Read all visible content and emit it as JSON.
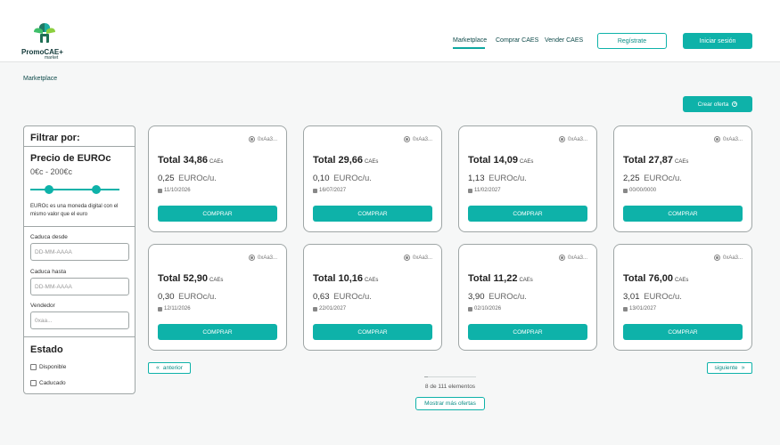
{
  "brand": {
    "name": "PromoCAE+",
    "sub": "market"
  },
  "nav": {
    "items": [
      "Marketplace",
      "Comprar CAES",
      "Vender CAES"
    ],
    "register_label": "Regístrate",
    "login_label": "Iniciar sesión"
  },
  "breadcrumb": "Marketplace",
  "create_offer_label": "Crear oferta",
  "filter": {
    "title": "Filtrar por:",
    "price_title": "Precio de EUROc",
    "price_range": "0€c - 200€c",
    "price_slider_min_fraction": 0.21,
    "price_slider_max_fraction": 0.74,
    "note": "EUROc es una moneda digital con el mismo valor que el euro",
    "caduca_desde_label": "Caduca desde",
    "caduca_desde_placeholder": "DD-MM-AAAA",
    "caduca_hasta_label": "Caduca hasta",
    "caduca_hasta_placeholder": "DD-MM-AAAA",
    "vendedor_label": "Vendedor",
    "vendedor_placeholder": "0xaa...",
    "estado_title": "Estado",
    "disponible_label": "Disponible",
    "caducado_label": "Caducado"
  },
  "offers": [
    {
      "seller": "0xAa3...",
      "total": "Total 34,86",
      "cae": "CAEs",
      "price": "0,25",
      "unit": "EUROc/u.",
      "date": "11/10/2026",
      "buy": "COMPRAR"
    },
    {
      "seller": "0xAa3...",
      "total": "Total 29,66",
      "cae": "CAEs",
      "price": "0,10",
      "unit": "EUROc/u.",
      "date": "16/07/2027",
      "buy": "COMPRAR"
    },
    {
      "seller": "0xAa3...",
      "total": "Total 14,09",
      "cae": "CAEs",
      "price": "1,13",
      "unit": "EUROc/u.",
      "date": "11/02/2027",
      "buy": "COMPRAR"
    },
    {
      "seller": "0xAa3...",
      "total": "Total 27,87",
      "cae": "CAEs",
      "price": "2,25",
      "unit": "EUROc/u.",
      "date": "00/00/0000",
      "buy": "COMPRAR"
    },
    {
      "seller": "0xAa3...",
      "total": "Total 52,90",
      "cae": "CAEs",
      "price": "0,30",
      "unit": "EUROc/u.",
      "date": "12/11/2026",
      "buy": "COMPRAR"
    },
    {
      "seller": "0xAa3...",
      "total": "Total 10,16",
      "cae": "CAEs",
      "price": "0,63",
      "unit": "EUROc/u.",
      "date": "22/01/2027",
      "buy": "COMPRAR"
    },
    {
      "seller": "0xAa3...",
      "total": "Total 11,22",
      "cae": "CAEs",
      "price": "3,90",
      "unit": "EUROc/u.",
      "date": "02/10/2026",
      "buy": "COMPRAR"
    },
    {
      "seller": "0xAa3...",
      "total": "Total 76,00",
      "cae": "CAEs",
      "price": "3,01",
      "unit": "EUROc/u.",
      "date": "13/01/2027",
      "buy": "COMPRAR"
    }
  ],
  "pagination": {
    "prev_label": "anterior",
    "next_label": "siguiente",
    "count_text": "8 de 111 elementos",
    "progress_fraction": 0.072,
    "more_label": "Mostrar más ofertas"
  },
  "colors": {
    "accent": "#0eb2a9",
    "border": "#9fa6a6"
  },
  "icons": [
    "logo-leaf-icon",
    "plus-circle-icon",
    "user-avatar-icon",
    "calendar-icon",
    "double-chevron-left-icon",
    "double-chevron-right-icon"
  ]
}
